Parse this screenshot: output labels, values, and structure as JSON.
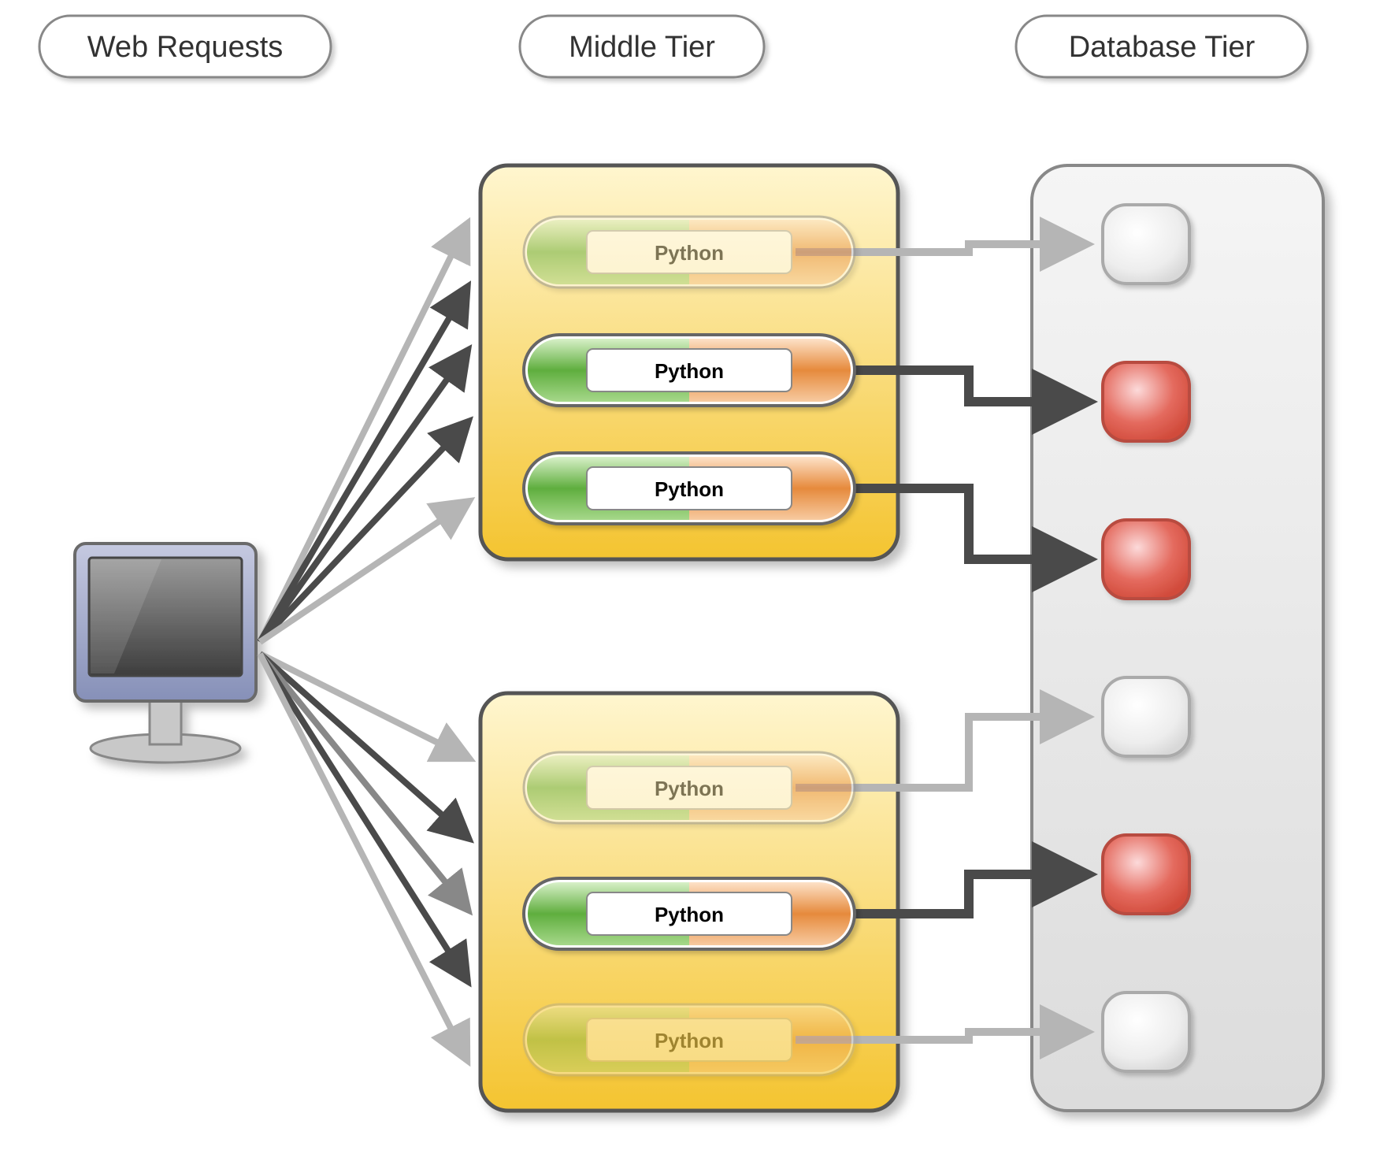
{
  "headers": {
    "web": "Web Requests",
    "middle": "Middle Tier",
    "database": "Database Tier"
  },
  "middle_tier": {
    "box1": {
      "pills": [
        {
          "label": "Python",
          "opacity": 0.5
        },
        {
          "label": "Python",
          "opacity": 1.0
        },
        {
          "label": "Python",
          "opacity": 1.0
        }
      ]
    },
    "box2": {
      "pills": [
        {
          "label": "Python",
          "opacity": 0.5
        },
        {
          "label": "Python",
          "opacity": 1.0
        },
        {
          "label": "Python",
          "opacity": 0.35
        }
      ]
    }
  },
  "database_tier": {
    "nodes": [
      {
        "active": false
      },
      {
        "active": true
      },
      {
        "active": true
      },
      {
        "active": false
      },
      {
        "active": true
      },
      {
        "active": false
      }
    ]
  },
  "arrows": {
    "client_to_middle": [
      {
        "strength": "light"
      },
      {
        "strength": "dark"
      },
      {
        "strength": "dark"
      },
      {
        "strength": "dark"
      },
      {
        "strength": "light"
      },
      {
        "strength": "light"
      },
      {
        "strength": "dark"
      },
      {
        "strength": "medium"
      },
      {
        "strength": "dark"
      },
      {
        "strength": "light"
      }
    ],
    "middle_to_db": [
      {
        "strength": "light"
      },
      {
        "strength": "dark"
      },
      {
        "strength": "dark"
      },
      {
        "strength": "light"
      },
      {
        "strength": "dark"
      },
      {
        "strength": "light"
      }
    ]
  }
}
